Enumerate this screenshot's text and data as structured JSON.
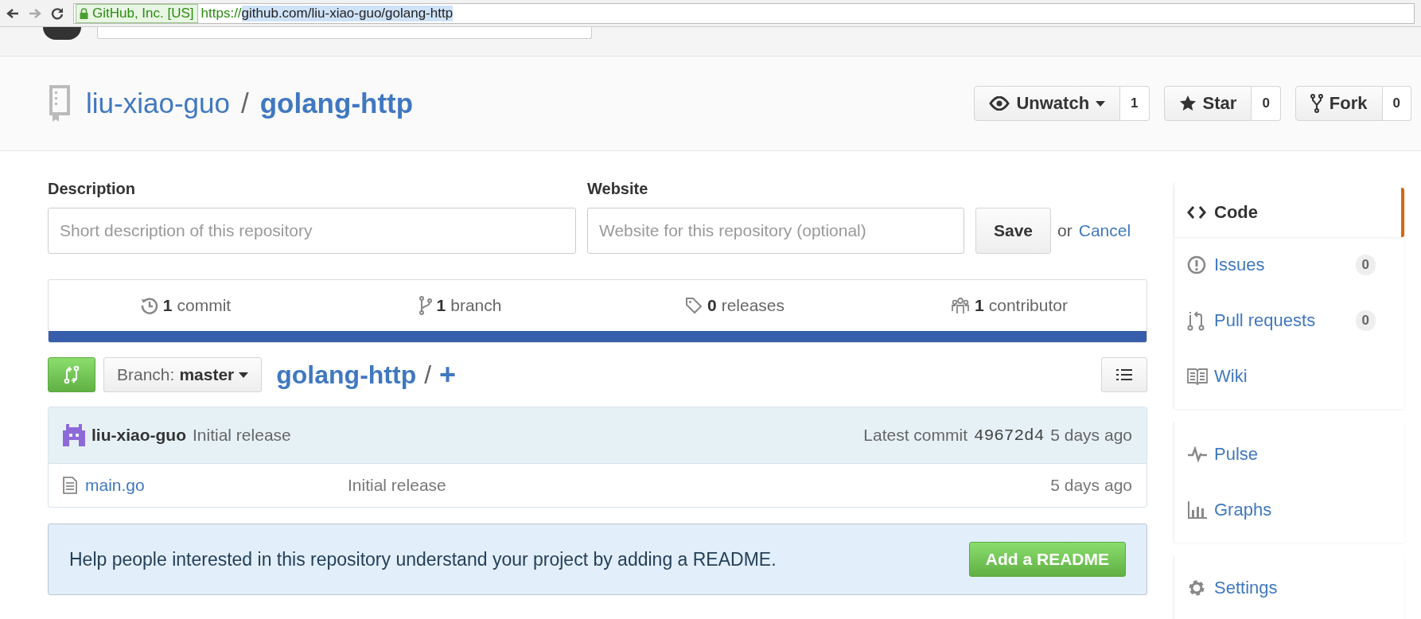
{
  "browser": {
    "identity": "GitHub, Inc. [US]",
    "url_scheme": "https://",
    "url_rest": "github.com/liu-xiao-guo/golang-http"
  },
  "repo": {
    "owner": "liu-xiao-guo",
    "separator": "/",
    "name": "golang-http"
  },
  "actions": [
    {
      "kind": "watch",
      "label": "Unwatch",
      "count": "1"
    },
    {
      "kind": "star",
      "label": "Star",
      "count": "0"
    },
    {
      "kind": "fork",
      "label": "Fork",
      "count": "0"
    }
  ],
  "form": {
    "description_label": "Description",
    "description_placeholder": "Short description of this repository",
    "website_label": "Website",
    "website_placeholder": "Website for this repository (optional)",
    "save": "Save",
    "or": "or",
    "cancel": "Cancel"
  },
  "stats": [
    {
      "kind": "commit",
      "count": "1",
      "label": "commit"
    },
    {
      "kind": "branch",
      "count": "1",
      "label": "branch"
    },
    {
      "kind": "tag",
      "count": "0",
      "label": "releases"
    },
    {
      "kind": "people",
      "count": "1",
      "label": "contributor"
    }
  ],
  "branch": {
    "prefix": "Branch:",
    "name": "master",
    "path": "golang-http",
    "sep": "/",
    "add": "+"
  },
  "commit": {
    "author": "liu-xiao-guo",
    "message": "Initial release",
    "latest_label": "Latest commit",
    "sha": "49672d4",
    "age": "5 days ago"
  },
  "files": [
    {
      "name": "main.go",
      "message": "Initial release",
      "age": "5 days ago"
    }
  ],
  "readme": {
    "text": "Help people interested in this repository understand your project by adding a README.",
    "button": "Add a README"
  },
  "sidebar": {
    "groups": [
      [
        {
          "kind": "code",
          "label": "Code",
          "selected": true
        },
        {
          "kind": "issues",
          "label": "Issues",
          "count": "0",
          "selected": false
        },
        {
          "kind": "pull",
          "label": "Pull requests",
          "count": "0",
          "selected": false
        },
        {
          "kind": "wiki",
          "label": "Wiki",
          "selected": false
        }
      ],
      [
        {
          "kind": "pulse",
          "label": "Pulse",
          "selected": false
        },
        {
          "kind": "graphs",
          "label": "Graphs",
          "selected": false
        }
      ],
      [
        {
          "kind": "settings",
          "label": "Settings",
          "selected": false
        }
      ]
    ]
  }
}
